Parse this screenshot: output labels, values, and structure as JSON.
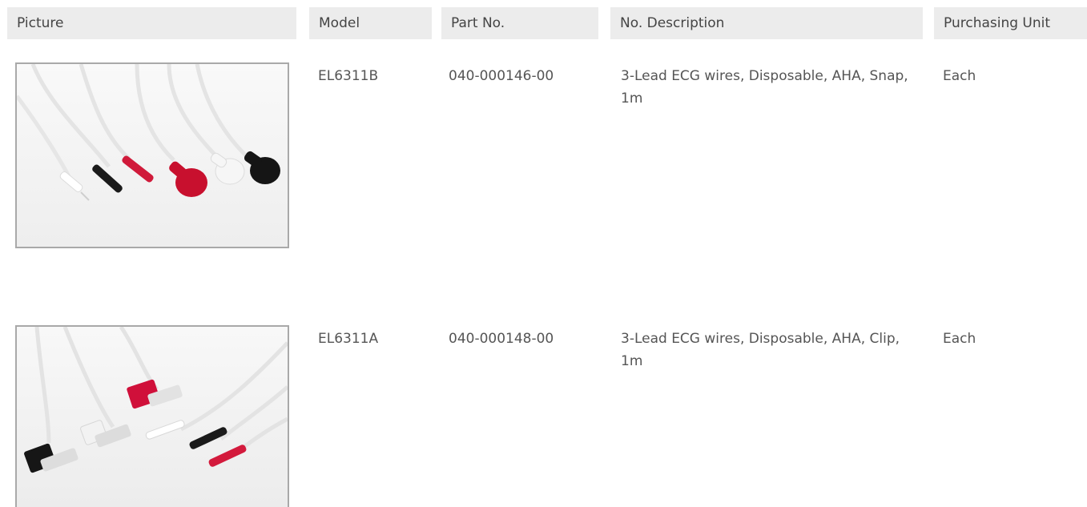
{
  "table": {
    "headers": {
      "picture": "Picture",
      "model": "Model",
      "part_no": "Part No.",
      "description": "No. Description",
      "purchasing_unit": "Purchasing Unit"
    },
    "rows": [
      {
        "model": "EL6311B",
        "part_no": "040-000146-00",
        "description": "3-Lead ECG wires, Disposable, AHA, Snap, 1m",
        "purchasing_unit": "Each"
      },
      {
        "model": "EL6311A",
        "part_no": "040-000148-00",
        "description": "3-Lead ECG wires, Disposable, AHA, Clip, 1m",
        "purchasing_unit": "Each"
      }
    ]
  }
}
